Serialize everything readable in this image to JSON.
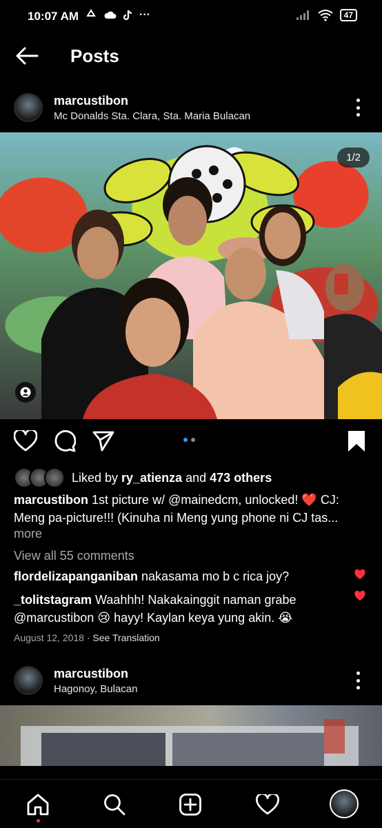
{
  "status_bar": {
    "time": "10:07 AM",
    "more": "···",
    "battery": "47"
  },
  "header": {
    "title": "Posts"
  },
  "post1": {
    "username": "marcustibon",
    "location": "Mc Donalds Sta. Clara, Sta. Maria Bulacan",
    "counter": "1/2",
    "liked_by_prefix": "Liked by ",
    "liked_by_user": "ry_atienza",
    "liked_by_mid": " and ",
    "liked_by_count": "473 others",
    "caption_user": "marcustibon",
    "caption_line1": " 1st picture w/ @mainedcm, unlocked! ❤️ CJ:",
    "caption_line2": "Meng pa-picture!!! (Kinuha ni Meng yung phone ni CJ tas...",
    "more": "more",
    "view_all": "View all 55 comments",
    "comments": [
      {
        "user": "flordelizapanganiban",
        "text": " nakasama mo b c rica joy?"
      },
      {
        "user": "_tolitstagram",
        "text": " Waahhh! Nakakainggit naman grabe @marcustibon 😢 hayy! Kaylan keya yung akin. 😭"
      }
    ],
    "date": "August 12, 2018",
    "see_translation": " · See Translation"
  },
  "post2": {
    "username": "marcustibon",
    "location": "Hagonoy, Bulacan"
  },
  "icons": [
    "back-arrow-icon",
    "kebab-icon",
    "heart-icon",
    "comment-icon",
    "send-icon",
    "bookmark-icon",
    "home-icon",
    "search-icon",
    "create-icon",
    "activity-heart-icon",
    "profile-avatar"
  ],
  "colors": {
    "accent_blue": "#3897f0",
    "like_red": "#ff3040",
    "muted": "#a8a8a8"
  }
}
